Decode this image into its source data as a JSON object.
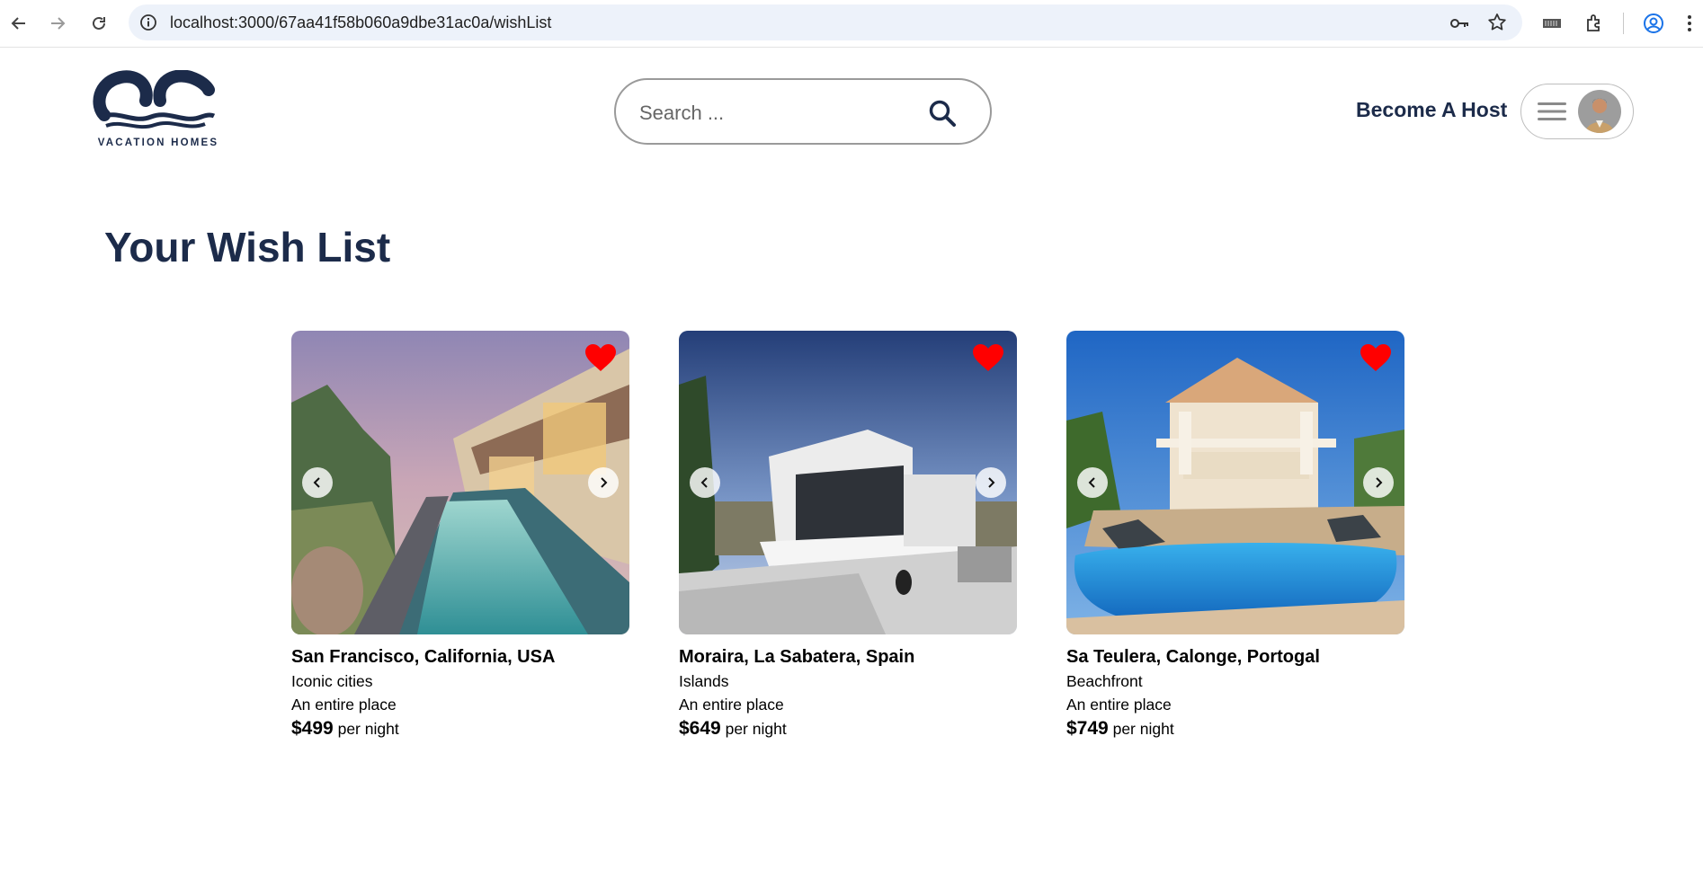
{
  "browser": {
    "url": "localhost:3000/67aa41f58b060a9dbe31ac0a/wishList",
    "icons": [
      "back-icon",
      "forward-icon",
      "reload-icon",
      "site-info-icon",
      "password-key-icon",
      "bookmark-star-icon",
      "barcode-extension-icon",
      "extensions-puzzle-icon",
      "profile-icon",
      "more-vert-icon"
    ]
  },
  "header": {
    "logo_text": "VACATION HOMES",
    "search_placeholder": "Search ...",
    "become_host": "Become A Host"
  },
  "page": {
    "title": "Your Wish List"
  },
  "colors": {
    "brand_navy": "#1c2b4a",
    "heart_red": "#ff0000"
  },
  "listings": [
    {
      "location": "San Francisco, California, USA",
      "category": "Iconic cities",
      "type": "An entire place",
      "price": "$499",
      "price_suffix": "per night",
      "favorited": true
    },
    {
      "location": "Moraira, La Sabatera, Spain",
      "category": "Islands",
      "type": "An entire place",
      "price": "$649",
      "price_suffix": "per night",
      "favorited": true
    },
    {
      "location": "Sa Teulera, Calonge, Portogal",
      "category": "Beachfront",
      "type": "An entire place",
      "price": "$749",
      "price_suffix": "per night",
      "favorited": true
    }
  ]
}
